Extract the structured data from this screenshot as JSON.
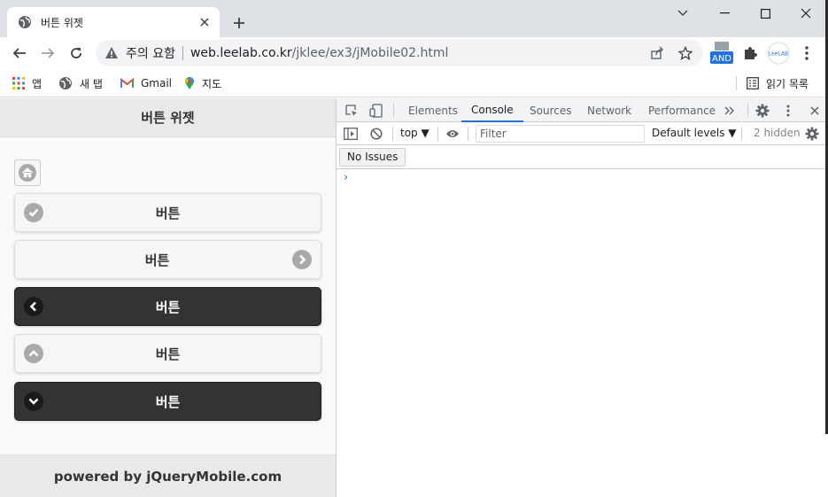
{
  "browser": {
    "tab_title": "버튼 위젯",
    "url_warning": "주의 요함",
    "url_domain": "web.leelab.co.kr",
    "url_path": "/jklee/ex3/jMobile02.html",
    "extension_label": "AND",
    "extension2_label": "LeeLAB"
  },
  "bookmarks": {
    "apps": "앱",
    "new_tab": "새 탭",
    "gmail": "Gmail",
    "maps": "지도",
    "reading_list": "읽기 목록"
  },
  "page": {
    "header_title": "버튼 위젯",
    "buttons": [
      {
        "label": "버튼",
        "icon": "check-icon",
        "icon_pos": "left",
        "theme": "light"
      },
      {
        "label": "버튼",
        "icon": "arrow-right-icon",
        "icon_pos": "right",
        "theme": "light"
      },
      {
        "label": "버튼",
        "icon": "arrow-left-icon",
        "icon_pos": "left",
        "theme": "dark"
      },
      {
        "label": "버튼",
        "icon": "arrow-up-icon",
        "icon_pos": "left",
        "theme": "light"
      },
      {
        "label": "버튼",
        "icon": "arrow-down-icon",
        "icon_pos": "left",
        "theme": "dark"
      }
    ],
    "footer_text": "powered by jQueryMobile.com"
  },
  "devtools": {
    "tabs": [
      "Elements",
      "Console",
      "Sources",
      "Network",
      "Performance"
    ],
    "active_tab": "Console",
    "context": "top",
    "filter_placeholder": "Filter",
    "levels": "Default levels",
    "hidden_count": "2 hidden",
    "issues": "No Issues",
    "prompt": "›"
  },
  "colors": {
    "accent": "#1a73e8",
    "dark_button": "#333333",
    "light_button": "#f6f6f6"
  }
}
